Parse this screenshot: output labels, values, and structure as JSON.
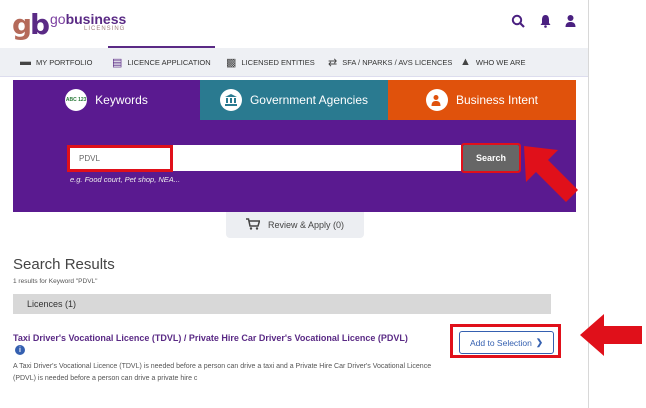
{
  "header": {
    "logo_go": "go",
    "logo_business": "business",
    "logo_sub": "LICENSING",
    "icons": [
      "search-icon",
      "bell-icon",
      "user-icon"
    ]
  },
  "nav": {
    "items": [
      {
        "label": "MY PORTFOLIO",
        "icon": "briefcase-icon"
      },
      {
        "label": "LICENCE APPLICATION",
        "icon": "document-icon"
      },
      {
        "label": "LICENSED ENTITIES",
        "icon": "truck-icon"
      },
      {
        "label": "SFA / NPARKS / AVS LICENCES",
        "icon": "exchange-icon"
      },
      {
        "label": "WHO WE ARE",
        "icon": "building-icon"
      }
    ]
  },
  "tabs": [
    {
      "label": "Keywords",
      "badge": "ABC 123",
      "color": "#5a1a90"
    },
    {
      "label": "Government Agencies",
      "color": "#2a7a90"
    },
    {
      "label": "Business Intent",
      "color": "#e0520c"
    }
  ],
  "search": {
    "value": "PDVL",
    "button": "Search",
    "example": "e.g. Food court, Pet shop, NEA..."
  },
  "review": {
    "label": "Review & Apply (0)"
  },
  "results": {
    "title": "Search Results",
    "subtitle": "1 results for Keyword \"PDVL\"",
    "section": "Licences (1)",
    "licence_title": "Taxi Driver's Vocational Licence (TDVL) / Private Hire Car Driver's Vocational Licence (PDVL)",
    "description": "A Taxi Driver's Vocational Licence (TDVL) is needed before a person can drive a taxi and a Private Hire Car Driver's Vocational Licence (PDVL) is needed before a person can drive a private hire c",
    "add_button": "Add to Selection"
  },
  "colors": {
    "brand": "#5a1a90",
    "highlight": "#e0101a",
    "link": "#3560b0"
  }
}
